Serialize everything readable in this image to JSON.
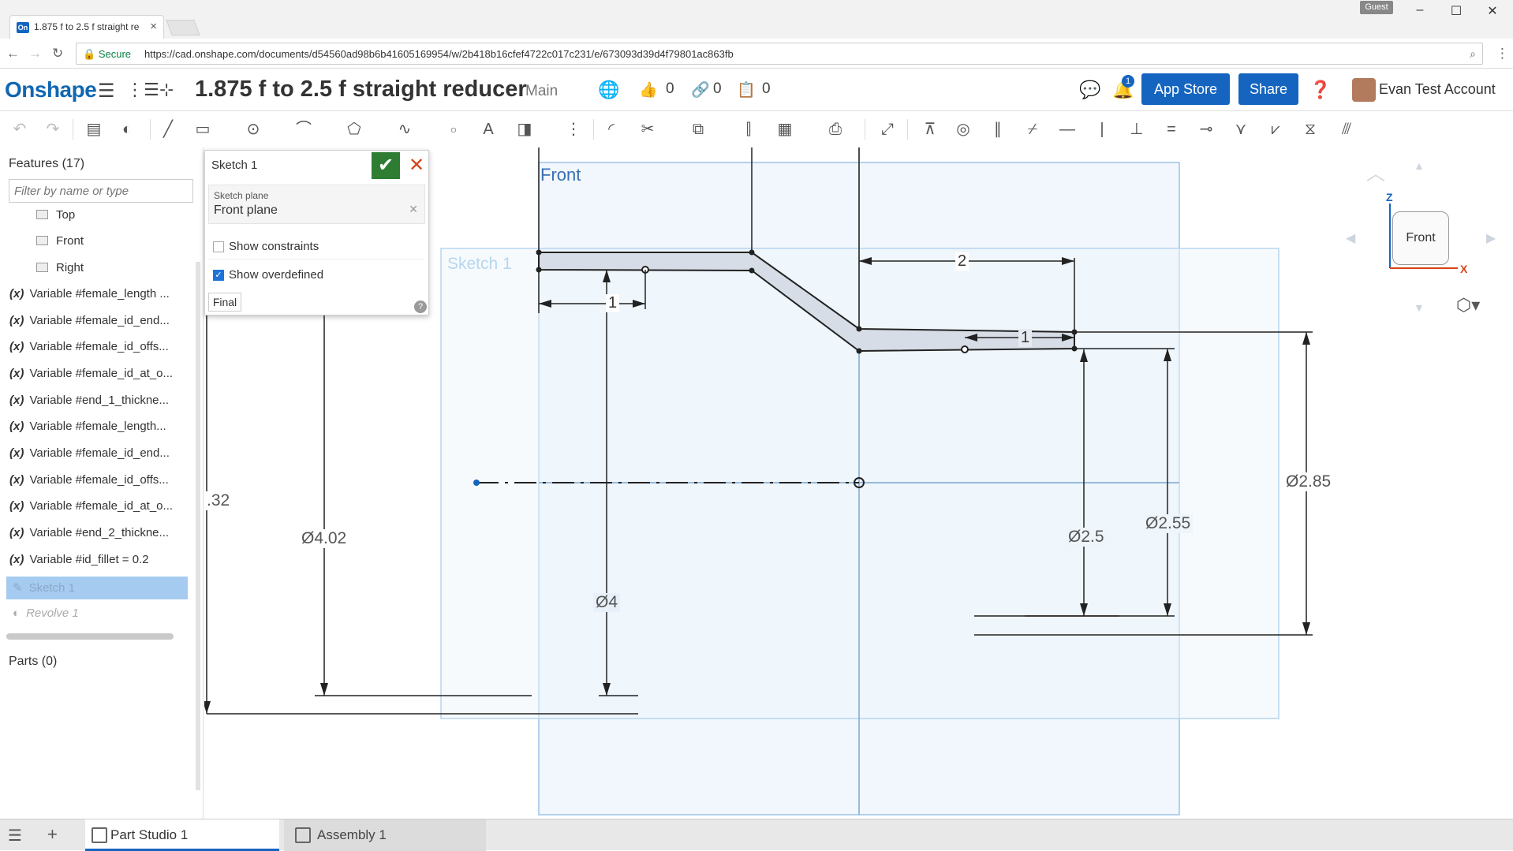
{
  "browser": {
    "tab_title": "1.875 f to 2.5 f straight re",
    "tab_favicon": "On",
    "guest_label": "Guest",
    "secure_label": "Secure",
    "url": "https://cad.onshape.com/documents/d54560ad98b6b41605169954/w/2b418b16cfef4722c017c231/e/673093d39d4f79801ac863fb"
  },
  "header": {
    "logo": "Onshape",
    "document_title": "1.875 f to 2.5 f straight reducer",
    "workspace": "Main",
    "likes": "0",
    "links": "0",
    "copies": "0",
    "notification_count": "1",
    "app_store_label": "App Store",
    "share_label": "Share",
    "user_name": "Evan Test Account"
  },
  "features": {
    "title": "Features (17)",
    "filter_placeholder": "Filter by name or type",
    "planes": [
      "Top",
      "Front",
      "Right"
    ],
    "variables": [
      "Variable #female_length ...",
      "Variable #female_id_end...",
      "Variable #female_id_offs...",
      "Variable #female_id_at_o...",
      "Variable #end_1_thickne...",
      "Variable #female_length...",
      "Variable #female_id_end...",
      "Variable #female_id_offs...",
      "Variable #female_id_at_o...",
      "Variable #end_2_thickne...",
      "Variable #id_fillet = 0.2"
    ],
    "variable_prefix": "(x)",
    "sketch_item": "Sketch 1",
    "revolve_item": "Revolve 1",
    "parts_title": "Parts (0)"
  },
  "sketch_dialog": {
    "title": "Sketch 1",
    "plane_label": "Sketch plane",
    "plane_value": "Front plane",
    "show_constraints_label": "Show constraints",
    "show_constraints_checked": false,
    "show_overdefined_label": "Show overdefined",
    "show_overdefined_checked": true,
    "final_label": "Final",
    "help": "?"
  },
  "canvas": {
    "plane_label": "Front",
    "sketch_label": "Sketch 1",
    "dimensions": {
      "dim_1_left": "1",
      "dim_2": "2",
      "dim_1_right": "1",
      "dia_285": "Ø2.85",
      "dia_255": "Ø2.55",
      "dia_25": "Ø2.5",
      "dia_402": "Ø4.02",
      "dia_4": "Ø4",
      "partial_32": ".32"
    }
  },
  "viewcube": {
    "face": "Front",
    "axis_z": "Z",
    "axis_x": "X"
  },
  "bottom_tabs": [
    {
      "label": "Part Studio 1",
      "active": true
    },
    {
      "label": "Assembly 1",
      "active": false
    }
  ],
  "colors": {
    "accent": "#1565c0",
    "confirm": "#2e7d32",
    "cancel": "#d84315",
    "selection": "#a5cbf1",
    "plane_fill": "#e8f1fa",
    "plane_stroke": "#9cc4e8"
  }
}
